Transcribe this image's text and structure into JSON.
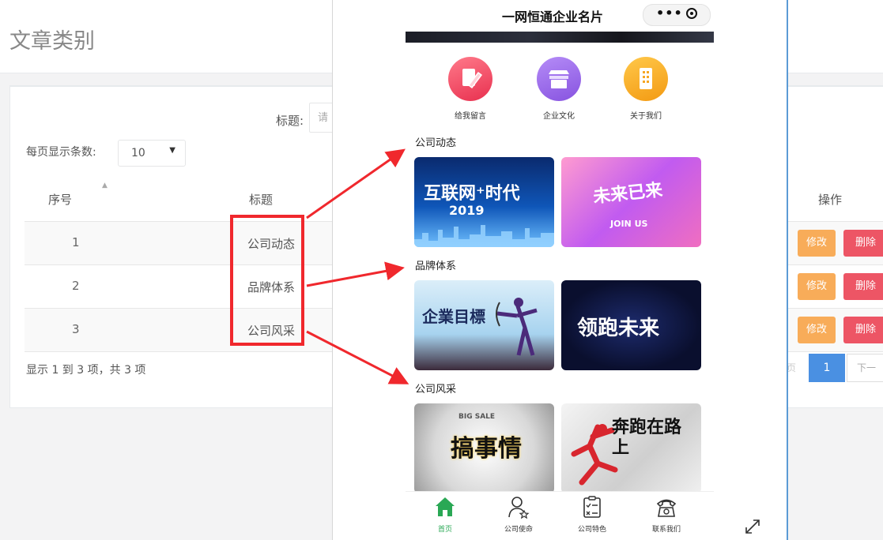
{
  "admin": {
    "page_title": "文章类别",
    "search": {
      "label": "标题:",
      "placeholder": "请"
    },
    "page_size": {
      "label": "每页显示条数:",
      "value": "10"
    },
    "columns": {
      "seq": "序号",
      "title": "标题",
      "actions": "操作"
    },
    "rows": [
      {
        "seq": "1",
        "title": "公司动态"
      },
      {
        "seq": "2",
        "title": "品牌体系"
      },
      {
        "seq": "3",
        "title": "公司风采"
      }
    ],
    "actions": {
      "edit": "修改",
      "delete": "删除"
    },
    "summary": "显示 1 到 3 项，共 3 项",
    "pagination": {
      "prev": "上一页",
      "current": "1",
      "next": "下一页"
    }
  },
  "phone": {
    "title": "一网恒通企业名片",
    "capsule": {
      "more": "•••"
    },
    "quick_links": [
      {
        "label": "给我留言",
        "icon": "edit-note-icon",
        "color": "#f0476a"
      },
      {
        "label": "企业文化",
        "icon": "store-icon",
        "color": "#9a66e4"
      },
      {
        "label": "关于我们",
        "icon": "building-icon",
        "color": "#f6a623"
      }
    ],
    "sections": [
      {
        "title": "公司动态",
        "images": [
          {
            "text": "互联网⁺时代",
            "sub": "2019"
          },
          {
            "text": "未来已来",
            "sub": "JOIN US"
          }
        ]
      },
      {
        "title": "品牌体系",
        "images": [
          {
            "text": "企業目標",
            "sub": ""
          },
          {
            "text": "领跑未来",
            "sub": ""
          }
        ]
      },
      {
        "title": "公司风采",
        "images": [
          {
            "text": "搞事情",
            "sub": "BIG SALE"
          },
          {
            "text": "奔跑在路上",
            "sub": ""
          }
        ]
      }
    ],
    "tabbar": [
      {
        "label": "首页",
        "icon": "home-icon",
        "active": true
      },
      {
        "label": "公司使命",
        "icon": "user-star-icon",
        "active": false
      },
      {
        "label": "公司特色",
        "icon": "checklist-icon",
        "active": false
      },
      {
        "label": "联系我们",
        "icon": "telephone-icon",
        "active": false
      }
    ]
  },
  "colors": {
    "edit_button": "#f8ac59",
    "delete_button": "#ed5565",
    "pagination_active": "#4a90e2",
    "annotation_red": "#f0282d",
    "tab_active": "#2aa855"
  }
}
